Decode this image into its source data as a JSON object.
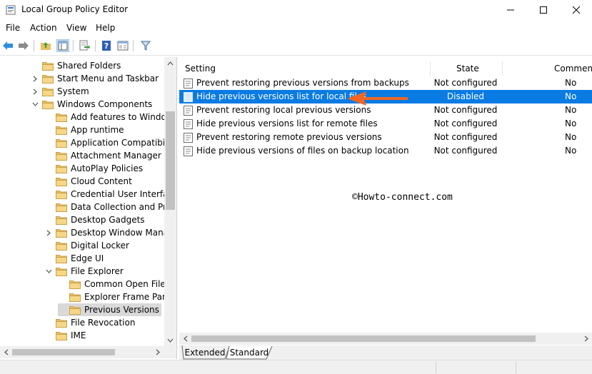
{
  "window": {
    "title": "Local Group Policy Editor"
  },
  "menu": [
    "File",
    "Action",
    "View",
    "Help"
  ],
  "toolbar": [
    "back-arrow-icon",
    "forward-arrow-icon",
    "up-folder-icon",
    "show-hide-tree-icon",
    "export-list-icon",
    "help-icon",
    "properties-icon",
    "filter-icon"
  ],
  "tree": [
    {
      "label": "Shared Folders",
      "depth": 1,
      "chevron": "none"
    },
    {
      "label": "Start Menu and Taskbar",
      "depth": 1,
      "chevron": "right"
    },
    {
      "label": "System",
      "depth": 1,
      "chevron": "right"
    },
    {
      "label": "Windows Components",
      "depth": 1,
      "chevron": "down"
    },
    {
      "label": "Add features to Window",
      "depth": 2,
      "chevron": "none"
    },
    {
      "label": "App runtime",
      "depth": 2,
      "chevron": "none"
    },
    {
      "label": "Application Compatibilit",
      "depth": 2,
      "chevron": "none"
    },
    {
      "label": "Attachment Manager",
      "depth": 2,
      "chevron": "none"
    },
    {
      "label": "AutoPlay Policies",
      "depth": 2,
      "chevron": "none"
    },
    {
      "label": "Cloud Content",
      "depth": 2,
      "chevron": "none"
    },
    {
      "label": "Credential User Interface",
      "depth": 2,
      "chevron": "none"
    },
    {
      "label": "Data Collection and Prev",
      "depth": 2,
      "chevron": "none"
    },
    {
      "label": "Desktop Gadgets",
      "depth": 2,
      "chevron": "none"
    },
    {
      "label": "Desktop Window Manag",
      "depth": 2,
      "chevron": "right"
    },
    {
      "label": "Digital Locker",
      "depth": 2,
      "chevron": "none"
    },
    {
      "label": "Edge UI",
      "depth": 2,
      "chevron": "none"
    },
    {
      "label": "File Explorer",
      "depth": 2,
      "chevron": "down"
    },
    {
      "label": "Common Open File D",
      "depth": 3,
      "chevron": "none"
    },
    {
      "label": "Explorer Frame Pane",
      "depth": 3,
      "chevron": "none"
    },
    {
      "label": "Previous Versions",
      "depth": 3,
      "chevron": "none",
      "selected": true
    },
    {
      "label": "File Revocation",
      "depth": 2,
      "chevron": "none"
    },
    {
      "label": "IME",
      "depth": 2,
      "chevron": "none"
    }
  ],
  "columns": {
    "setting": "Setting",
    "state": "State",
    "comment": "Comment"
  },
  "policies": [
    {
      "name": "Prevent restoring previous versions from backups",
      "state": "Not configured",
      "comment": "No"
    },
    {
      "name": "Hide previous versions list for local files",
      "state": "Disabled",
      "comment": "No",
      "selected": true
    },
    {
      "name": "Prevent restoring local previous versions",
      "state": "Not configured",
      "comment": "No"
    },
    {
      "name": "Hide previous versions list for remote files",
      "state": "Not configured",
      "comment": "No"
    },
    {
      "name": "Prevent restoring remote previous versions",
      "state": "Not configured",
      "comment": "No"
    },
    {
      "name": "Hide previous versions of files on backup location",
      "state": "Not configured",
      "comment": "No"
    }
  ],
  "watermark": "©Howto-connect.com",
  "tabs": {
    "extended": "Extended",
    "standard": "Standard"
  },
  "colors": {
    "selection": "#0a7be3",
    "arrow": "#f26522",
    "folder": "#e8c067"
  }
}
